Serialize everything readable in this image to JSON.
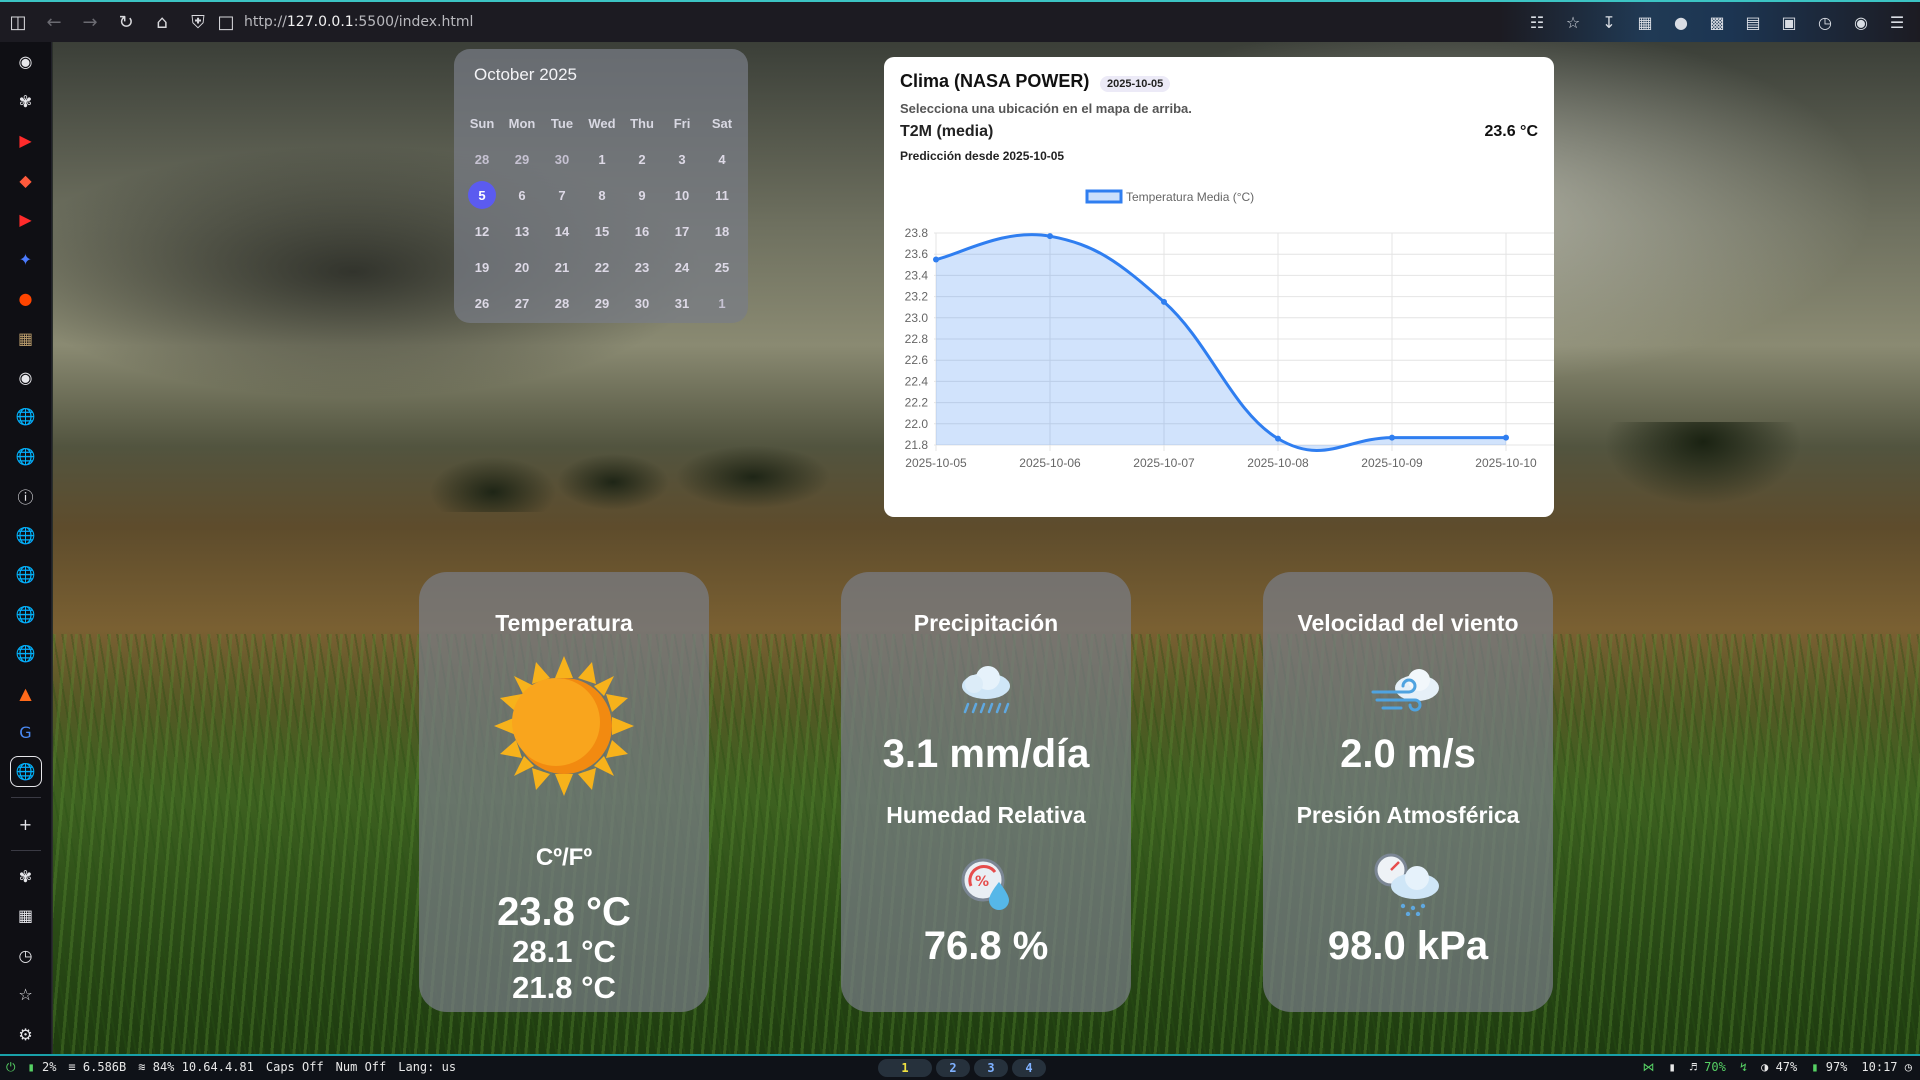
{
  "browser": {
    "url_prefix": "http://",
    "url_host": "127.0.0.1",
    "url_rest": ":5500/index.html"
  },
  "calendar": {
    "title": "October 2025",
    "weekdays": [
      "Sun",
      "Mon",
      "Tue",
      "Wed",
      "Thu",
      "Fri",
      "Sat"
    ],
    "weeks": [
      [
        "28",
        "29",
        "30",
        "1",
        "2",
        "3",
        "4"
      ],
      [
        "5",
        "6",
        "7",
        "8",
        "9",
        "10",
        "11"
      ],
      [
        "12",
        "13",
        "14",
        "15",
        "16",
        "17",
        "18"
      ],
      [
        "19",
        "20",
        "21",
        "22",
        "23",
        "24",
        "25"
      ],
      [
        "26",
        "27",
        "28",
        "29",
        "30",
        "31",
        "1"
      ]
    ],
    "selected_day": "5",
    "accent": "#5b5bf0"
  },
  "climate": {
    "title": "Clima (NASA POWER)",
    "date_badge": "2025-10-05",
    "subtitle": "Selecciona una ubicación en el mapa de arriba.",
    "metric_label": "T2M (media)",
    "metric_value": "23.6 °C",
    "prediction": "Predicción desde 2025-10-05"
  },
  "chart_data": {
    "type": "line",
    "fill": true,
    "x": [
      "2025-10-05",
      "2025-10-06",
      "2025-10-07",
      "2025-10-08",
      "2025-10-09",
      "2025-10-10"
    ],
    "series": [
      {
        "name": "Temperatura Media (°C)",
        "values": [
          23.55,
          23.77,
          23.15,
          21.86,
          21.87,
          21.87
        ],
        "color": "#2f7ef0"
      }
    ],
    "yticks": [
      "23.8",
      "23.6",
      "23.4",
      "23.2",
      "23.0",
      "22.8",
      "22.6",
      "22.4",
      "22.2",
      "22.0",
      "21.8"
    ],
    "ylim": [
      21.8,
      23.8
    ],
    "grid": true,
    "legend": "top"
  },
  "cards": {
    "temperature": {
      "heading": "Temperatura",
      "icon": "sun-icon",
      "unit_toggle": "Cº/Fº",
      "avg": "23.8 °C",
      "max": "28.1 °C",
      "min": "21.8 °C"
    },
    "precipitation": {
      "heading": "Precipitación",
      "icon": "rain-cloud-icon",
      "value": "3.1 mm/día",
      "humidity_heading": "Humedad Relativa",
      "humidity_icon": "humidity-gauge-icon",
      "humidity_value": "76.8 %"
    },
    "wind": {
      "heading": "Velocidad del viento",
      "icon": "windy-cloud-icon",
      "value": "2.0 m/s",
      "pressure_heading": "Presión Atmosférica",
      "pressure_icon": "pressure-gauge-cloud-icon",
      "pressure_value": "98.0 kPa"
    }
  },
  "statusbar": {
    "cpu": "2%",
    "mem": "6.586B",
    "net": "84% 10.64.4.81",
    "caps": "Caps Off",
    "num": "Num Off",
    "lang": "Lang: us",
    "workspaces": [
      "1",
      "2",
      "3",
      "4"
    ],
    "volume": "70%",
    "brightness": "47%",
    "battery": "97%",
    "clock": "10:17"
  }
}
